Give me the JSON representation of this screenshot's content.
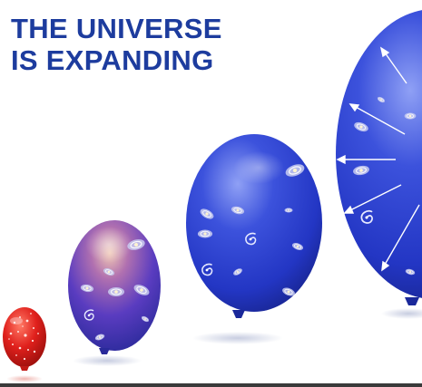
{
  "title": {
    "line1": "THE UNIVERSE",
    "line2": "IS EXPANDING"
  },
  "colors": {
    "title": "#1d3c9e",
    "balloon_blue": "#2c3fd0",
    "balloon_violet": "#6a3fb0",
    "balloon_red": "#e0201c",
    "arrow": "#ffffff",
    "galaxy": "#d8dcf4"
  },
  "stages": [
    {
      "stage": 1,
      "icon": "red-balloon",
      "contents": "stars"
    },
    {
      "stage": 2,
      "icon": "violet-balloon",
      "contents": "galaxies"
    },
    {
      "stage": 3,
      "icon": "blue-balloon",
      "contents": "galaxies"
    },
    {
      "stage": 4,
      "icon": "large-blue-balloon",
      "contents": "galaxies",
      "arrows": "expansion-arrows"
    }
  ]
}
